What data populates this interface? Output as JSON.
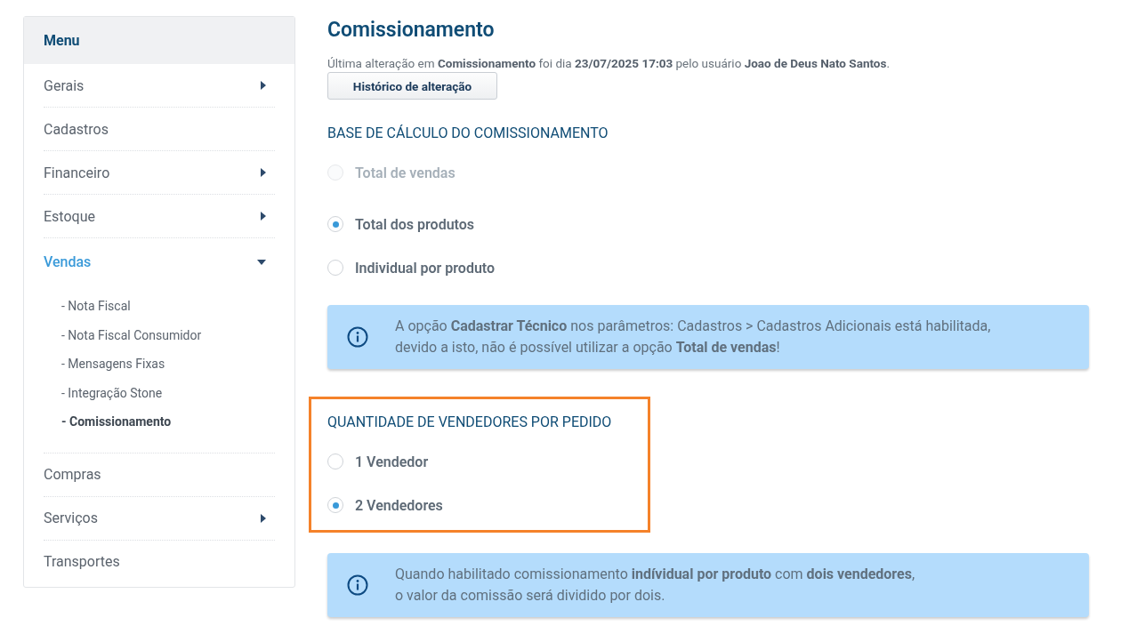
{
  "sidebar": {
    "title": "Menu",
    "items": [
      {
        "label": "Gerais",
        "expandable": true,
        "expanded": false,
        "selected": false
      },
      {
        "label": "Cadastros",
        "expandable": false,
        "expanded": false,
        "selected": false
      },
      {
        "label": "Financeiro",
        "expandable": true,
        "expanded": false,
        "selected": false
      },
      {
        "label": "Estoque",
        "expandable": true,
        "expanded": false,
        "selected": false
      },
      {
        "label": "Vendas",
        "expandable": true,
        "expanded": true,
        "selected": true,
        "children": [
          {
            "label": "- Nota Fiscal",
            "selected": false
          },
          {
            "label": "- Nota Fiscal Consumidor",
            "selected": false
          },
          {
            "label": "- Mensagens Fixas",
            "selected": false
          },
          {
            "label": "- Integração Stone",
            "selected": false
          },
          {
            "label": "- Comissionamento",
            "selected": true
          }
        ]
      },
      {
        "label": "Compras",
        "expandable": false,
        "expanded": false,
        "selected": false
      },
      {
        "label": "Serviços",
        "expandable": true,
        "expanded": false,
        "selected": false
      },
      {
        "label": "Transportes",
        "expandable": false,
        "expanded": false,
        "selected": false
      }
    ]
  },
  "page": {
    "title": "Comissionamento",
    "last_change": "Última alteração em **Comissionamento** foi dia **23/07/2025 17:03** pelo usuário **Joao de Deus Nato Santos**.",
    "history_button": "Histórico de alteração"
  },
  "sections": [
    {
      "kind": "radios",
      "title": "BASE DE CÁLCULO DO COMISSIONAMENTO",
      "highlighted": false,
      "options": [
        {
          "label": "Total de vendas",
          "selected": false,
          "disabled": true
        },
        {
          "label": "Total dos produtos",
          "selected": true,
          "disabled": false
        },
        {
          "label": "Individual por produto",
          "selected": false,
          "disabled": false
        }
      ]
    },
    {
      "kind": "info",
      "lines": [
        "A opção **Cadastrar Técnico** nos parâmetros: Cadastros > Cadastros Adicionais está habilitada,",
        "devido a isto, não é possível utilizar a opção **Total de vendas**!"
      ]
    },
    {
      "kind": "radios",
      "title": "QUANTIDADE DE VENDEDORES POR PEDIDO",
      "highlighted": true,
      "options": [
        {
          "label": "1 Vendedor",
          "selected": false,
          "disabled": false
        },
        {
          "label": "2 Vendedores",
          "selected": true,
          "disabled": false
        }
      ]
    },
    {
      "kind": "info",
      "lines": [
        "Quando habilitado comissionamento **indívidual por produto** com **dois vendedores**,",
        "o valor da comissão será dividido por dois."
      ]
    }
  ]
}
